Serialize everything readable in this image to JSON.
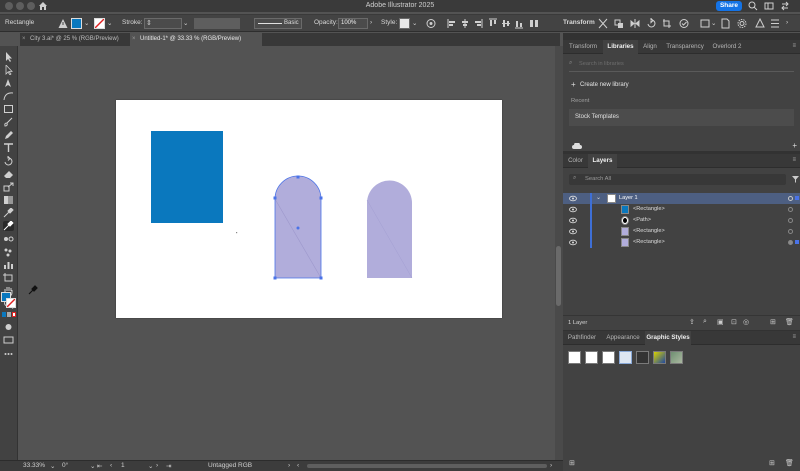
{
  "app": {
    "title": "Adobe Illustrator 2025",
    "share_label": "Share"
  },
  "control_bar": {
    "selection_label": "Rectangle",
    "stroke_label": "Stroke:",
    "stroke_style": "Basic",
    "opacity_label": "Opacity:",
    "opacity_value": "100%",
    "style_label": "Style:",
    "transform_label": "Transform",
    "fill_color": "#0a78be"
  },
  "document_tabs": [
    {
      "label": "City 3.ai* @ 25 % (RGB/Preview)",
      "active": false
    },
    {
      "label": "Untitled-1* @ 33.33 % (RGB/Preview)",
      "active": true
    }
  ],
  "artboard": {
    "rect_color": "#0a78be",
    "arch_color": "#b1addb",
    "selection_color": "#4a73e8"
  },
  "status_bar": {
    "zoom": "33.33%",
    "rotation": "0°",
    "artboard_number": "1",
    "color_profile": "Untagged RGB"
  },
  "top_panel": {
    "tabs": [
      "Transform",
      "Libraries",
      "Align",
      "Transparency",
      "Overlord 2"
    ],
    "active_tab": "Libraries",
    "search_placeholder": "Search in libraries",
    "create_library": "Create new library",
    "recent_label": "Recent",
    "stock_templates": "Stock Templates"
  },
  "layers_panel": {
    "tabs": [
      "Color",
      "Layers"
    ],
    "active_tab": "Layers",
    "search_placeholder": "Search All",
    "layers": [
      {
        "name": "Layer 1",
        "kind": "layer"
      },
      {
        "name": "<Rectangle>",
        "kind": "rect-blue"
      },
      {
        "name": "<Path>",
        "kind": "path"
      },
      {
        "name": "<Rectangle>",
        "kind": "rect-purple"
      },
      {
        "name": "<Rectangle>",
        "kind": "rect-purple"
      }
    ],
    "count_label": "1 Layer"
  },
  "bottom_panel": {
    "tabs": [
      "Pathfinder",
      "Appearance",
      "Graphic Styles"
    ],
    "active_tab": "Graphic Styles"
  }
}
